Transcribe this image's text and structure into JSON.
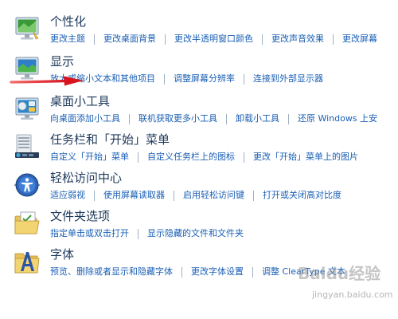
{
  "categories": [
    {
      "title": "个性化",
      "icon": "personalization-monitor-icon",
      "links": [
        "更改主题",
        "更改桌面背景",
        "更改半透明窗口颜色",
        "更改声音效果",
        "更改屏幕"
      ]
    },
    {
      "title": "显示",
      "icon": "display-monitor-icon",
      "links": [
        "放大或缩小文本和其他项目",
        "调整屏幕分辨率",
        "连接到外部显示器"
      ]
    },
    {
      "title": "桌面小工具",
      "icon": "gadgets-icon",
      "links": [
        "向桌面添加小工具",
        "联机获取更多小工具",
        "卸载小工具",
        "还原 Windows 上安"
      ]
    },
    {
      "title": "任务栏和「开始」菜单",
      "icon": "taskbar-icon",
      "links": [
        "自定义「开始」菜单",
        "自定义任务栏上的图标",
        "更改「开始」菜单上的图片"
      ]
    },
    {
      "title": "轻松访问中心",
      "icon": "ease-of-access-icon",
      "links": [
        "适应弱视",
        "使用屏幕读取器",
        "启用轻松访问键",
        "打开或关闭高对比度"
      ]
    },
    {
      "title": "文件夹选项",
      "icon": "folder-options-icon",
      "links": [
        "指定单击或双击打开",
        "显示隐藏的文件和文件夹"
      ]
    },
    {
      "title": "字体",
      "icon": "fonts-icon",
      "links": [
        "预览、删除或者显示和隐藏字体",
        "更改字体设置",
        "调整 ClearType 文本"
      ]
    }
  ],
  "watermark": {
    "text": "Baidu经验",
    "sub": "jingyan.baidu.com"
  },
  "colors": {
    "title": "#1e395b",
    "link": "#1a5fb4",
    "annotation_arrow": "#e0202a"
  }
}
